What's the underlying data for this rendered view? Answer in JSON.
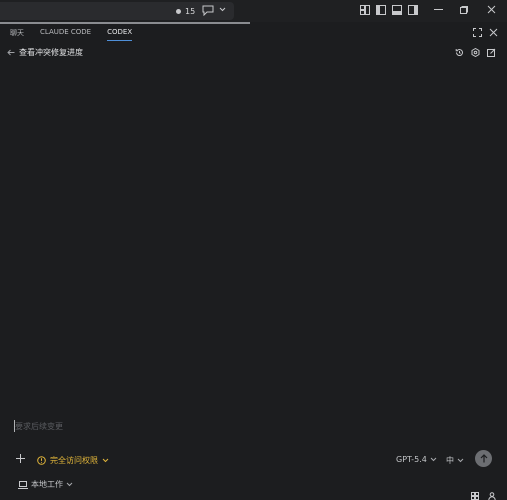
{
  "titlebar": {
    "notification_count": "15"
  },
  "tabs": [
    {
      "label": "聊天",
      "active": false
    },
    {
      "label": "CLAUDE CODE",
      "active": false
    },
    {
      "label": "CODEX",
      "active": true
    }
  ],
  "thread": {
    "title": "查看冲突修复进度"
  },
  "composer": {
    "placeholder": "要求后续变更",
    "permission_label": "完全访问权限",
    "model_label": "GPT-5.4",
    "effort_label": "中",
    "location_label": "本地工作"
  },
  "colors": {
    "accent": "#4f8fd8",
    "permission": "#e2b63a",
    "background": "#1c1d1f"
  }
}
